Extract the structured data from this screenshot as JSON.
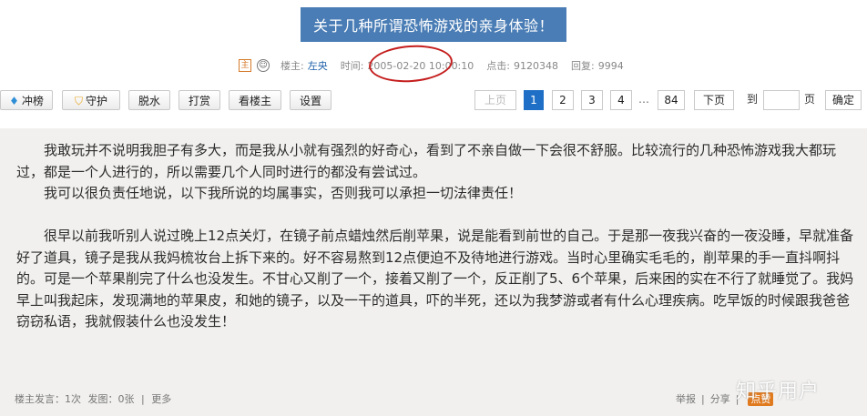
{
  "title": "关于几种所谓恐怖游戏的亲身体验！",
  "meta": {
    "host_label": "楼主:",
    "author": "左央",
    "time_label": "时间:",
    "time_value": "2005-02-20 10:00:10",
    "clicks_label": "点击:",
    "clicks_value": "9120348",
    "replies_label": "回复:",
    "replies_value": "9994"
  },
  "toolbar": {
    "btn_rank": "冲榜",
    "btn_guard": "守护",
    "btn_dewater": "脱水",
    "btn_tip": "打赏",
    "btn_view_host": "看楼主",
    "btn_settings": "设置"
  },
  "pagination": {
    "prev": "上页",
    "pages": [
      "1",
      "2",
      "3",
      "4"
    ],
    "ellipsis": "…",
    "last": "84",
    "next": "下页",
    "goto_label": "到",
    "page_unit": "页",
    "confirm": "确定",
    "current": 1
  },
  "content": {
    "p1": "我敢玩并不说明我胆子有多大，而是我从小就有强烈的好奇心，看到了不亲自做一下会很不舒服。比较流行的几种恐怖游戏我大都玩过，都是一个人进行的，所以需要几个人同时进行的都没有尝试过。",
    "p2": "我可以很负责任地说，以下我所说的均属事实，否则我可以承担一切法律责任！",
    "p3": "很早以前我听别人说过晚上12点关灯，在镜子前点蜡烛然后削苹果，说是能看到前世的自己。于是那一夜我兴奋的一夜没睡，早就准备好了道具，镜子是我从我妈梳妆台上拆下来的。好不容易熬到12点便迫不及待地进行游戏。当时心里确实毛毛的，削苹果的手一直抖啊抖的。可是一个苹果削完了什么也没发生。不甘心又削了一个，接着又削了一个，反正削了5、6个苹果，后来困的实在不行了就睡觉了。我妈早上叫我起床，发现满地的苹果皮，和她的镜子，以及一干的道具，吓的半死，还以为我梦游或者有什么心理疾病。吃早饭的时候跟我爸爸窃窃私语，我就假装什么也没发生！"
  },
  "footer": {
    "host_posts": "楼主发言：1次",
    "images": "发图：0张",
    "sep": "|",
    "more": "更多",
    "report": "举报",
    "share": "分享",
    "zan": "点赞"
  },
  "watermark": "知乎用户",
  "colors": {
    "title_bg": "#4a7db5",
    "active_page": "#1f6fc6",
    "annotation_circle": "#c51e1e",
    "content_bg": "#f1f0ee"
  }
}
